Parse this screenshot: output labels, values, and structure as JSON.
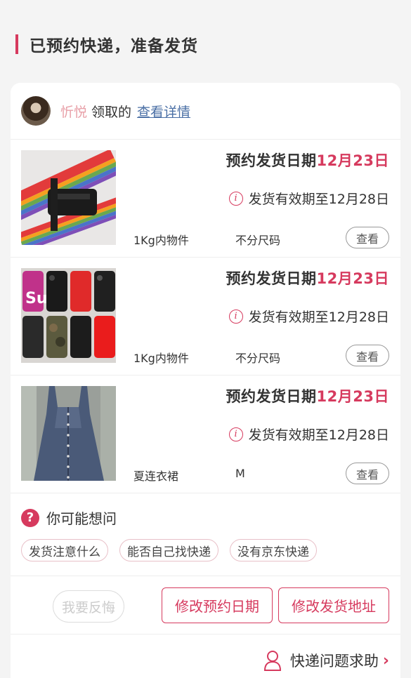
{
  "header": {
    "title": "已预约快递，准备发货"
  },
  "user": {
    "name": "忻悦",
    "action_text": "领取的",
    "detail_link": "查看详情"
  },
  "items": [
    {
      "date_label": "预约发货日期",
      "date_value": "12月23日",
      "validity": "发货有效期至12月28日",
      "spec1": "1Kg内物件",
      "spec2": "不分尺码",
      "view_label": "查看",
      "image": "rainbow-luggage-strap"
    },
    {
      "date_label": "预约发货日期",
      "date_value": "12月23日",
      "validity": "发货有效期至12月28日",
      "spec1": "1Kg内物件",
      "spec2": "不分尺码",
      "view_label": "查看",
      "image": "phone-cases"
    },
    {
      "date_label": "预约发货日期",
      "date_value": "12月23日",
      "validity": "发货有效期至12月28日",
      "spec1": "夏连衣裙",
      "spec2": "M",
      "view_label": "查看",
      "image": "denim-dress"
    }
  ],
  "faq": {
    "title": "你可能想问",
    "chips": [
      "发货注意什么",
      "能否自己找快递",
      "没有京东快递"
    ]
  },
  "actions": {
    "regret": "我要反悔",
    "change_date": "修改预约日期",
    "change_address": "修改发货地址"
  },
  "help": {
    "label": "快递问题求助"
  },
  "colors": {
    "accent": "#d63a5e",
    "link": "#4a6fa5"
  }
}
